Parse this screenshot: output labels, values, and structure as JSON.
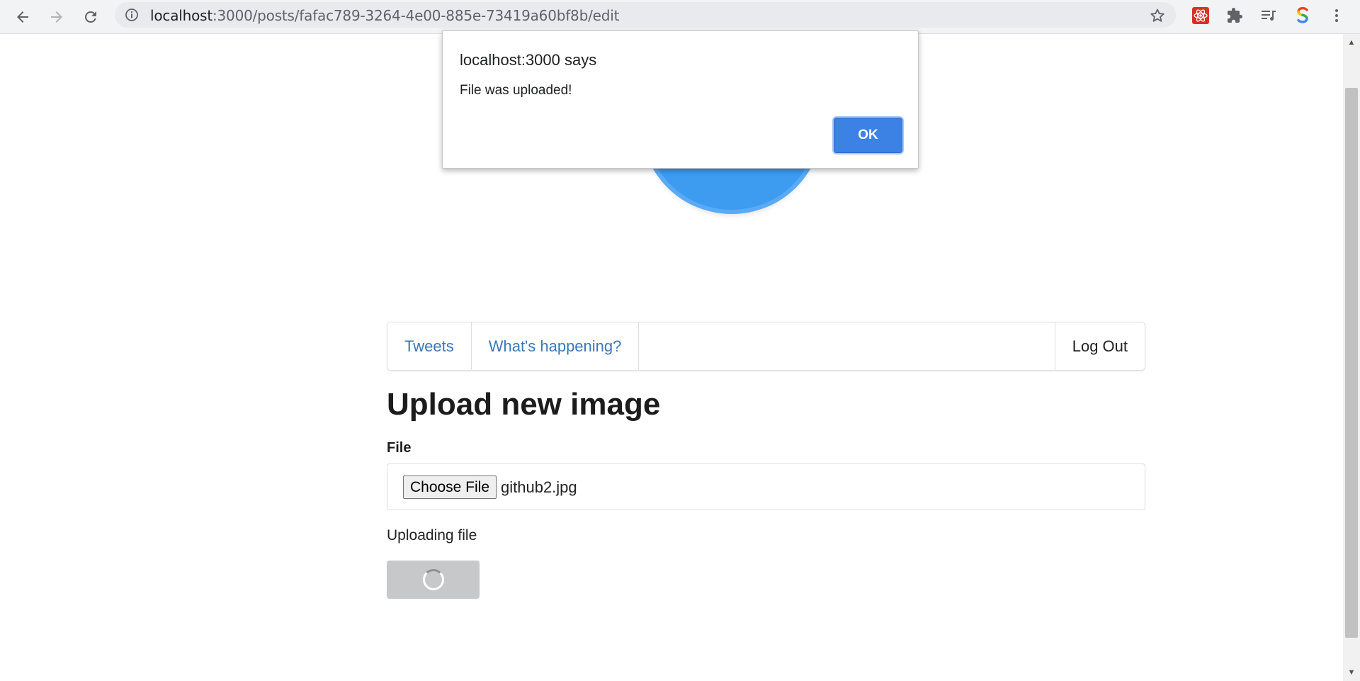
{
  "browser": {
    "url_host": "localhost",
    "url_path": ":3000/posts/fafac789-3264-4e00-885e-73419a60bf8b/edit",
    "icons": {
      "back": "arrow-left-icon",
      "forward": "arrow-right-icon",
      "reload": "reload-icon",
      "info": "info-icon",
      "bookmark": "star-icon",
      "extension_1": "react-devtools-icon",
      "extensions": "puzzle-icon",
      "media": "media-queue-icon",
      "extension_2": "s-extension-icon",
      "menu": "kebab-menu-icon"
    }
  },
  "dialog": {
    "title": "localhost:3000 says",
    "message": "File was uploaded!",
    "ok_label": "OK"
  },
  "nav": {
    "tweets": "Tweets",
    "whats_happening": "What's happening?",
    "logout": "Log Out"
  },
  "form": {
    "title": "Upload new image",
    "file_label": "File",
    "choose_file_label": "Choose File",
    "file_name": "github2.jpg",
    "status": "Uploading file"
  },
  "colors": {
    "link": "#3b78b8",
    "logo": "#3d9bf0",
    "ok_button": "#3b82e4",
    "disabled_button": "#c7c8ca"
  }
}
